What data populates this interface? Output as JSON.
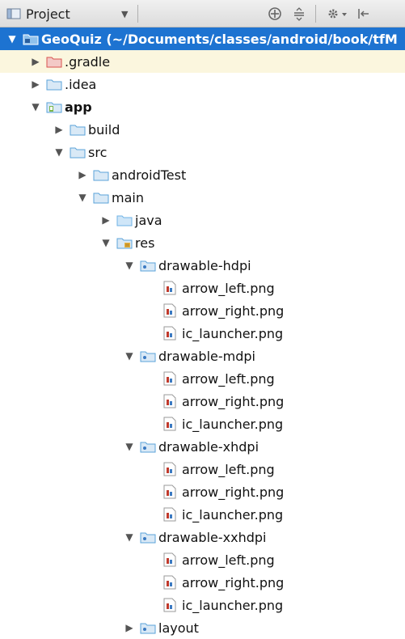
{
  "toolbar": {
    "title": "Project",
    "icons": [
      "locate-icon",
      "collapse-icon",
      "gear-icon",
      "hide-icon"
    ]
  },
  "colors": {
    "selection": "#1d73d1",
    "hover": "#fbf6de",
    "folder": "#5ba3d9",
    "folder_excluded": "#d9534f",
    "folder_source": "#6fb3e6",
    "file_red": "#c0392b"
  },
  "tree": [
    {
      "label": "GeoQuiz (~/Documents/classes/android/book/tfM",
      "depth": 0,
      "expanded": true,
      "icon": "project-folder-icon",
      "selected": true
    },
    {
      "label": ".gradle",
      "depth": 1,
      "expanded": false,
      "icon": "excluded-folder-icon",
      "hover": true
    },
    {
      "label": ".idea",
      "depth": 1,
      "expanded": false,
      "icon": "folder-icon"
    },
    {
      "label": "app",
      "depth": 1,
      "expanded": true,
      "icon": "module-folder-icon",
      "bold": true
    },
    {
      "label": "build",
      "depth": 2,
      "expanded": false,
      "icon": "folder-icon"
    },
    {
      "label": "src",
      "depth": 2,
      "expanded": true,
      "icon": "folder-icon"
    },
    {
      "label": "androidTest",
      "depth": 3,
      "expanded": false,
      "icon": "folder-icon"
    },
    {
      "label": "main",
      "depth": 3,
      "expanded": true,
      "icon": "folder-icon"
    },
    {
      "label": "java",
      "depth": 4,
      "expanded": false,
      "icon": "source-folder-icon"
    },
    {
      "label": "res",
      "depth": 4,
      "expanded": true,
      "icon": "resource-folder-icon"
    },
    {
      "label": "drawable-hdpi",
      "depth": 5,
      "expanded": true,
      "icon": "package-folder-icon"
    },
    {
      "label": "arrow_left.png",
      "depth": 6,
      "icon": "image-file-icon"
    },
    {
      "label": "arrow_right.png",
      "depth": 6,
      "icon": "image-file-icon"
    },
    {
      "label": "ic_launcher.png",
      "depth": 6,
      "icon": "image-file-icon"
    },
    {
      "label": "drawable-mdpi",
      "depth": 5,
      "expanded": true,
      "icon": "package-folder-icon"
    },
    {
      "label": "arrow_left.png",
      "depth": 6,
      "icon": "image-file-icon"
    },
    {
      "label": "arrow_right.png",
      "depth": 6,
      "icon": "image-file-icon"
    },
    {
      "label": "ic_launcher.png",
      "depth": 6,
      "icon": "image-file-icon"
    },
    {
      "label": "drawable-xhdpi",
      "depth": 5,
      "expanded": true,
      "icon": "package-folder-icon"
    },
    {
      "label": "arrow_left.png",
      "depth": 6,
      "icon": "image-file-icon"
    },
    {
      "label": "arrow_right.png",
      "depth": 6,
      "icon": "image-file-icon"
    },
    {
      "label": "ic_launcher.png",
      "depth": 6,
      "icon": "image-file-icon"
    },
    {
      "label": "drawable-xxhdpi",
      "depth": 5,
      "expanded": true,
      "icon": "package-folder-icon"
    },
    {
      "label": "arrow_left.png",
      "depth": 6,
      "icon": "image-file-icon"
    },
    {
      "label": "arrow_right.png",
      "depth": 6,
      "icon": "image-file-icon"
    },
    {
      "label": "ic_launcher.png",
      "depth": 6,
      "icon": "image-file-icon"
    },
    {
      "label": "layout",
      "depth": 5,
      "expanded": false,
      "icon": "package-folder-icon"
    }
  ]
}
